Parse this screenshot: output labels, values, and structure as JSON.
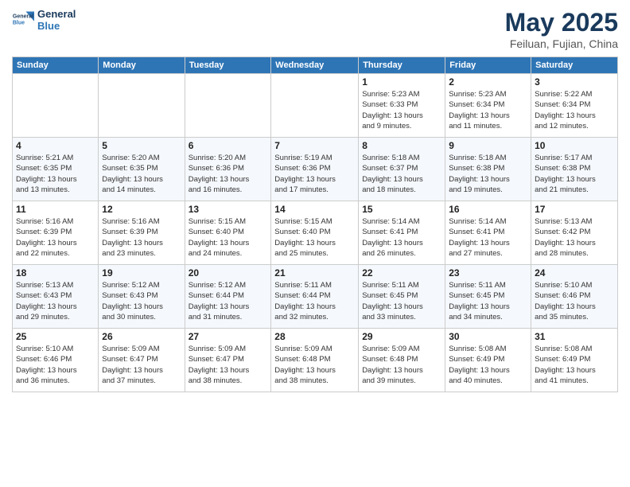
{
  "logo": {
    "line1": "General",
    "line2": "Blue"
  },
  "title": "May 2025",
  "subtitle": "Feiluan, Fujian, China",
  "weekdays": [
    "Sunday",
    "Monday",
    "Tuesday",
    "Wednesday",
    "Thursday",
    "Friday",
    "Saturday"
  ],
  "weeks": [
    [
      {
        "day": "",
        "info": ""
      },
      {
        "day": "",
        "info": ""
      },
      {
        "day": "",
        "info": ""
      },
      {
        "day": "",
        "info": ""
      },
      {
        "day": "1",
        "info": "Sunrise: 5:23 AM\nSunset: 6:33 PM\nDaylight: 13 hours\nand 9 minutes."
      },
      {
        "day": "2",
        "info": "Sunrise: 5:23 AM\nSunset: 6:34 PM\nDaylight: 13 hours\nand 11 minutes."
      },
      {
        "day": "3",
        "info": "Sunrise: 5:22 AM\nSunset: 6:34 PM\nDaylight: 13 hours\nand 12 minutes."
      }
    ],
    [
      {
        "day": "4",
        "info": "Sunrise: 5:21 AM\nSunset: 6:35 PM\nDaylight: 13 hours\nand 13 minutes."
      },
      {
        "day": "5",
        "info": "Sunrise: 5:20 AM\nSunset: 6:35 PM\nDaylight: 13 hours\nand 14 minutes."
      },
      {
        "day": "6",
        "info": "Sunrise: 5:20 AM\nSunset: 6:36 PM\nDaylight: 13 hours\nand 16 minutes."
      },
      {
        "day": "7",
        "info": "Sunrise: 5:19 AM\nSunset: 6:36 PM\nDaylight: 13 hours\nand 17 minutes."
      },
      {
        "day": "8",
        "info": "Sunrise: 5:18 AM\nSunset: 6:37 PM\nDaylight: 13 hours\nand 18 minutes."
      },
      {
        "day": "9",
        "info": "Sunrise: 5:18 AM\nSunset: 6:38 PM\nDaylight: 13 hours\nand 19 minutes."
      },
      {
        "day": "10",
        "info": "Sunrise: 5:17 AM\nSunset: 6:38 PM\nDaylight: 13 hours\nand 21 minutes."
      }
    ],
    [
      {
        "day": "11",
        "info": "Sunrise: 5:16 AM\nSunset: 6:39 PM\nDaylight: 13 hours\nand 22 minutes."
      },
      {
        "day": "12",
        "info": "Sunrise: 5:16 AM\nSunset: 6:39 PM\nDaylight: 13 hours\nand 23 minutes."
      },
      {
        "day": "13",
        "info": "Sunrise: 5:15 AM\nSunset: 6:40 PM\nDaylight: 13 hours\nand 24 minutes."
      },
      {
        "day": "14",
        "info": "Sunrise: 5:15 AM\nSunset: 6:40 PM\nDaylight: 13 hours\nand 25 minutes."
      },
      {
        "day": "15",
        "info": "Sunrise: 5:14 AM\nSunset: 6:41 PM\nDaylight: 13 hours\nand 26 minutes."
      },
      {
        "day": "16",
        "info": "Sunrise: 5:14 AM\nSunset: 6:41 PM\nDaylight: 13 hours\nand 27 minutes."
      },
      {
        "day": "17",
        "info": "Sunrise: 5:13 AM\nSunset: 6:42 PM\nDaylight: 13 hours\nand 28 minutes."
      }
    ],
    [
      {
        "day": "18",
        "info": "Sunrise: 5:13 AM\nSunset: 6:43 PM\nDaylight: 13 hours\nand 29 minutes."
      },
      {
        "day": "19",
        "info": "Sunrise: 5:12 AM\nSunset: 6:43 PM\nDaylight: 13 hours\nand 30 minutes."
      },
      {
        "day": "20",
        "info": "Sunrise: 5:12 AM\nSunset: 6:44 PM\nDaylight: 13 hours\nand 31 minutes."
      },
      {
        "day": "21",
        "info": "Sunrise: 5:11 AM\nSunset: 6:44 PM\nDaylight: 13 hours\nand 32 minutes."
      },
      {
        "day": "22",
        "info": "Sunrise: 5:11 AM\nSunset: 6:45 PM\nDaylight: 13 hours\nand 33 minutes."
      },
      {
        "day": "23",
        "info": "Sunrise: 5:11 AM\nSunset: 6:45 PM\nDaylight: 13 hours\nand 34 minutes."
      },
      {
        "day": "24",
        "info": "Sunrise: 5:10 AM\nSunset: 6:46 PM\nDaylight: 13 hours\nand 35 minutes."
      }
    ],
    [
      {
        "day": "25",
        "info": "Sunrise: 5:10 AM\nSunset: 6:46 PM\nDaylight: 13 hours\nand 36 minutes."
      },
      {
        "day": "26",
        "info": "Sunrise: 5:09 AM\nSunset: 6:47 PM\nDaylight: 13 hours\nand 37 minutes."
      },
      {
        "day": "27",
        "info": "Sunrise: 5:09 AM\nSunset: 6:47 PM\nDaylight: 13 hours\nand 38 minutes."
      },
      {
        "day": "28",
        "info": "Sunrise: 5:09 AM\nSunset: 6:48 PM\nDaylight: 13 hours\nand 38 minutes."
      },
      {
        "day": "29",
        "info": "Sunrise: 5:09 AM\nSunset: 6:48 PM\nDaylight: 13 hours\nand 39 minutes."
      },
      {
        "day": "30",
        "info": "Sunrise: 5:08 AM\nSunset: 6:49 PM\nDaylight: 13 hours\nand 40 minutes."
      },
      {
        "day": "31",
        "info": "Sunrise: 5:08 AM\nSunset: 6:49 PM\nDaylight: 13 hours\nand 41 minutes."
      }
    ]
  ]
}
